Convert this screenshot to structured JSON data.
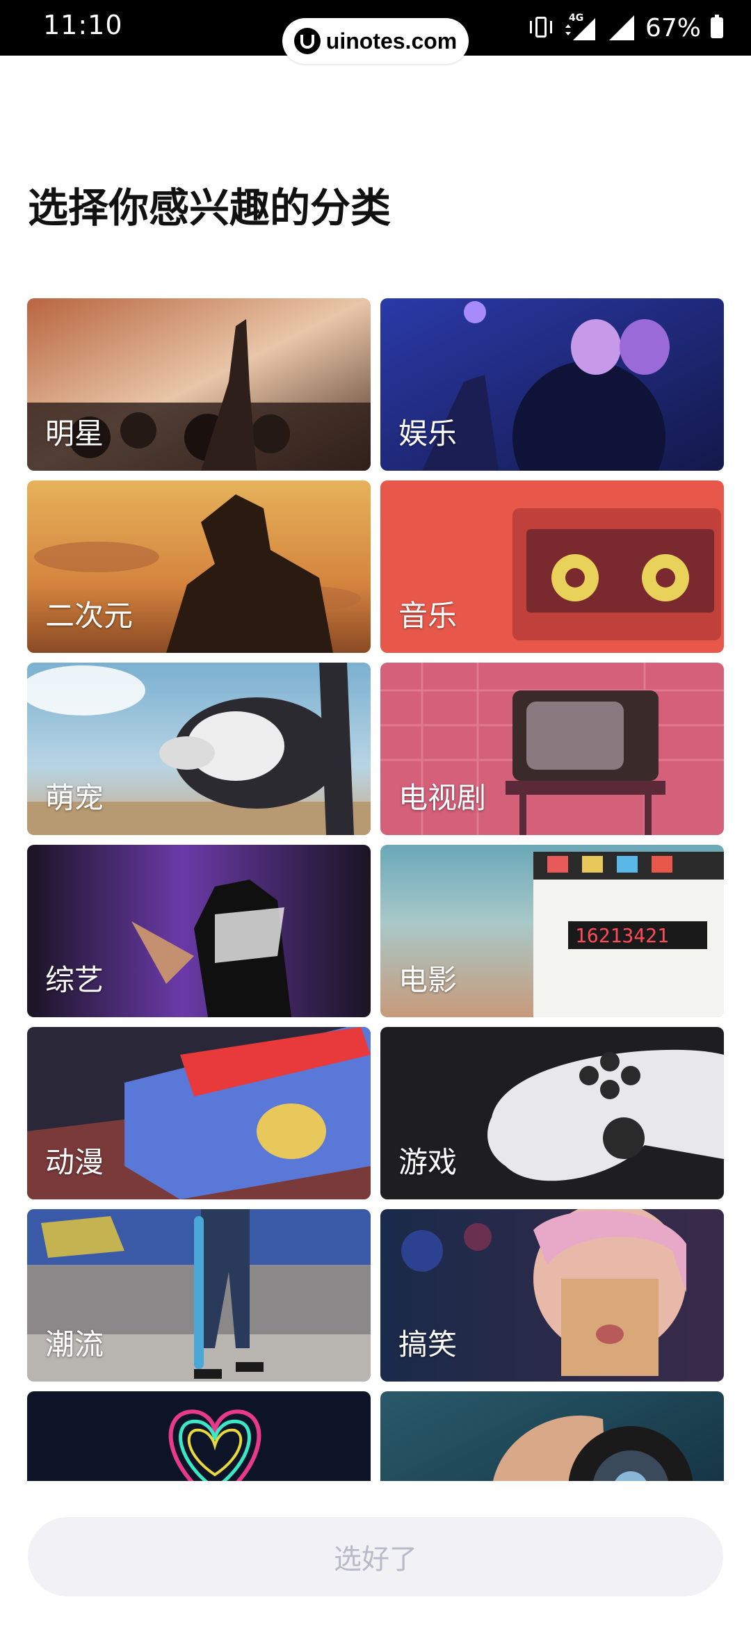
{
  "status_bar": {
    "time": "11:10",
    "network": "4G",
    "battery": "67%"
  },
  "watermark": "uinotes.com",
  "page": {
    "title": "选择你感兴趣的分类"
  },
  "categories": [
    {
      "label": "明星"
    },
    {
      "label": "娱乐"
    },
    {
      "label": "二次元"
    },
    {
      "label": "音乐"
    },
    {
      "label": "萌宠"
    },
    {
      "label": "电视剧"
    },
    {
      "label": "综艺"
    },
    {
      "label": "电影"
    },
    {
      "label": "动漫"
    },
    {
      "label": "游戏"
    },
    {
      "label": "潮流"
    },
    {
      "label": "搞笑"
    },
    {
      "label": ""
    },
    {
      "label": ""
    }
  ],
  "confirm_button": {
    "label": "选好了"
  }
}
